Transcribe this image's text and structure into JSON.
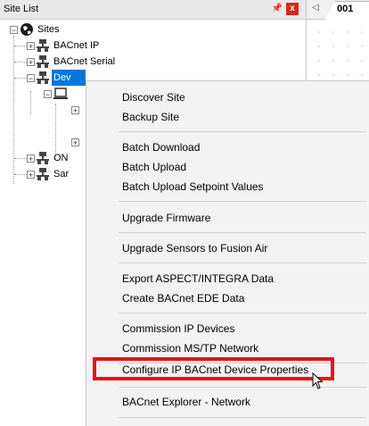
{
  "panel": {
    "title": "Site List",
    "pin_glyph": "ₐ",
    "close_glyph": "x"
  },
  "tree": {
    "root": {
      "label": "Sites",
      "icon": "globe-icon",
      "expander": "−"
    },
    "nodes": [
      {
        "label": "BACnet IP",
        "icon": "network-icon",
        "expander": "+"
      },
      {
        "label": "BACnet Serial",
        "icon": "network-icon",
        "expander": "+"
      },
      {
        "label": "Dev",
        "icon": "network-icon",
        "expander": "−",
        "selected": true
      },
      {
        "label": "",
        "icon": "controller-icon",
        "expander": "−"
      },
      {
        "label": "",
        "icon": "",
        "expander": "+"
      },
      {
        "label": "",
        "icon": "",
        "expander": "+"
      },
      {
        "label": "ON",
        "icon": "network-icon",
        "expander": "+"
      },
      {
        "label": "Sar",
        "icon": "network-icon",
        "expander": "+"
      }
    ]
  },
  "editor": {
    "tab_label": "001",
    "tab_arrow": "◁"
  },
  "context_menu": {
    "items": [
      {
        "label": "Discover Site"
      },
      {
        "label": "Backup Site"
      },
      {
        "label": "Batch Download"
      },
      {
        "label": "Batch Upload"
      },
      {
        "label": "Batch Upload Setpoint Values"
      },
      {
        "label": "Upgrade Firmware"
      },
      {
        "label": "Upgrade Sensors to Fusion Air"
      },
      {
        "label": "Export ASPECT/INTEGRA Data"
      },
      {
        "label": "Create BACnet EDE Data"
      },
      {
        "label": "Commission IP Devices"
      },
      {
        "label": "Commission MS/TP Network"
      },
      {
        "label": "Configure IP BACnet Device Properties"
      },
      {
        "label": "BACnet Explorer - Network"
      }
    ],
    "highlighted_item": "Configure IP BACnet Device Properties",
    "highlight_color": "#e4131c"
  },
  "colors": {
    "selection": "#0078d7",
    "close_button": "#d9261c",
    "menu_background": "#f2f2f2"
  }
}
